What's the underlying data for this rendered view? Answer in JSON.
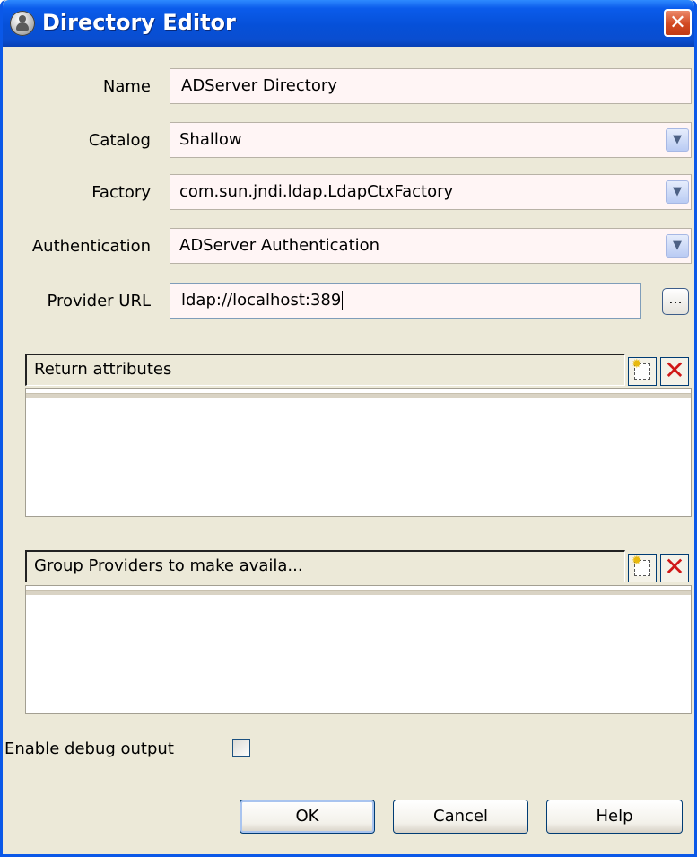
{
  "window": {
    "title": "Directory Editor",
    "icon": "user-icon",
    "close_glyph": "✕"
  },
  "form": {
    "name": {
      "label": "Name",
      "value": "ADServer Directory"
    },
    "catalog": {
      "label": "Catalog",
      "value": "Shallow"
    },
    "factory": {
      "label": "Factory",
      "value": "com.sun.jndi.ldap.LdapCtxFactory"
    },
    "authentication": {
      "label": "Authentication",
      "value": "ADServer Authentication"
    },
    "provider_url": {
      "label": "Provider URL",
      "value": "ldap://localhost:389",
      "browse_label": "..."
    }
  },
  "panels": {
    "return_attributes": {
      "header": "Return attributes"
    },
    "group_providers": {
      "header": "Group Providers to make availa..."
    }
  },
  "debug": {
    "label": "Enable debug output",
    "checked": false
  },
  "buttons": {
    "ok": "OK",
    "cancel": "Cancel",
    "help": "Help"
  },
  "colors": {
    "titlebar": "#0650D8",
    "dialog_bg": "#ECE9D8",
    "field_bg": "#FFF5F5",
    "close_button": "#D24A22",
    "delete_red": "#D01818"
  }
}
